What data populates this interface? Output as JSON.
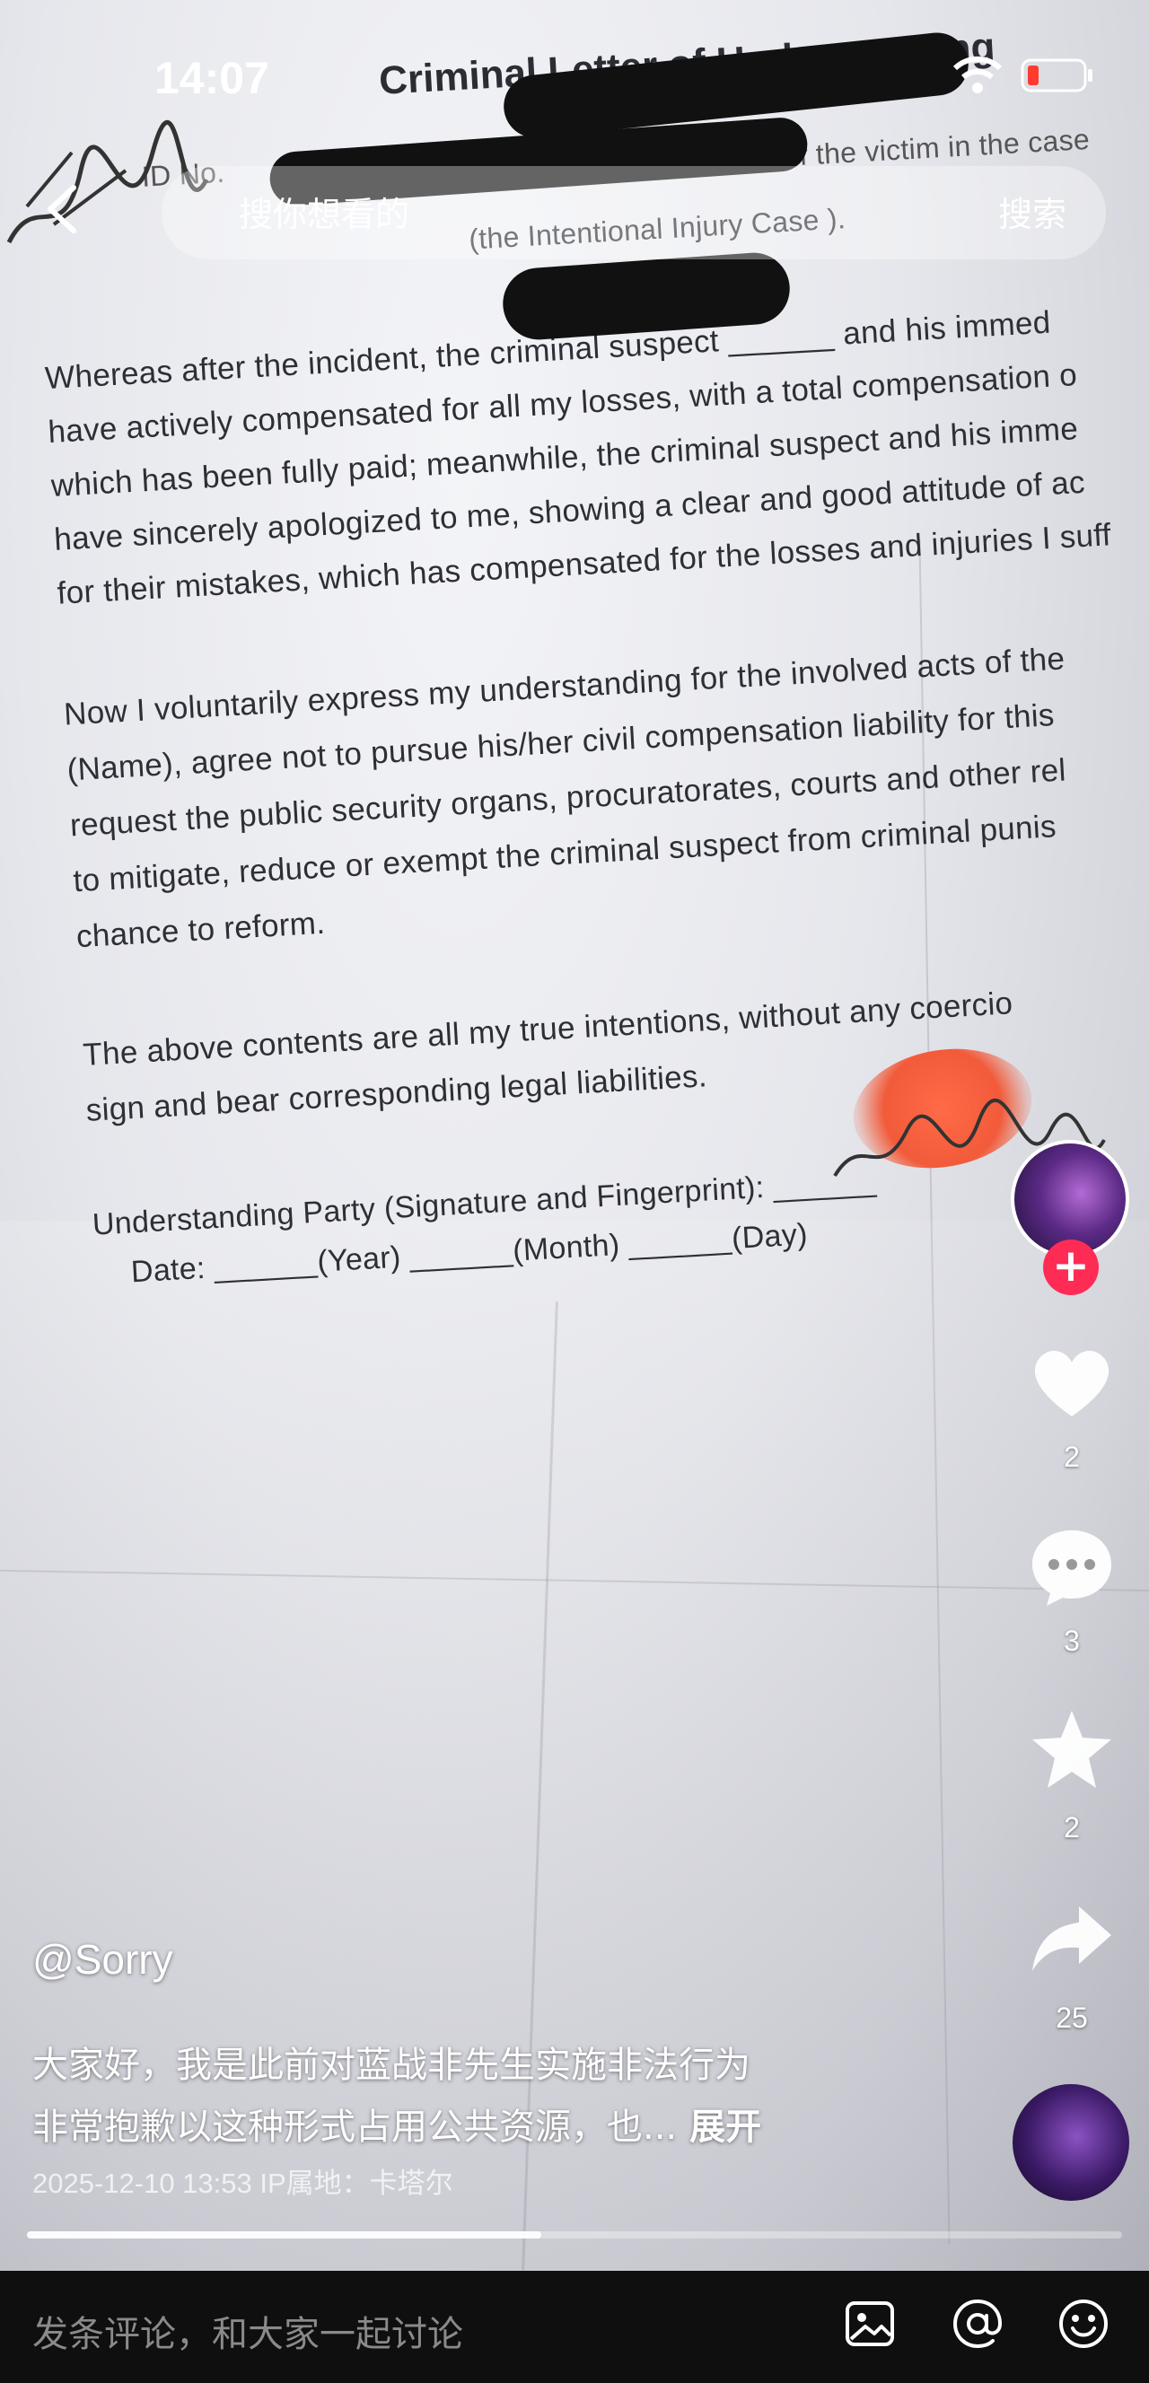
{
  "status_bar": {
    "time": "14:07"
  },
  "search": {
    "placeholder": "搜你想看的",
    "button": "搜索"
  },
  "document": {
    "title": "Criminal Letter of Understanding",
    "header_fragment_1": "ID No.",
    "header_fragment_2": "relative of the victim in the case",
    "case_line": "(the Intentional Injury Case ).",
    "paragraph_1": [
      "Whereas after the incident, the criminal suspect ______   and his immed",
      "have actively compensated for all my losses, with a total compensation o",
      "which has been fully paid; meanwhile, the criminal suspect and his imme",
      "have sincerely apologized to me, showing a clear and good attitude of ac",
      "for their mistakes, which has compensated for the losses and injuries I suff"
    ],
    "paragraph_2": [
      "Now I voluntarily express my understanding for the involved acts of the",
      "(Name), agree not to pursue his/her civil compensation liability for this",
      "request the public security organs, procuratorates, courts and other rel",
      "to mitigate, reduce or exempt the criminal suspect from criminal punis",
      "chance to reform."
    ],
    "paragraph_3": [
      "The above contents are all my true intentions, without any coercio",
      "sign and bear corresponding legal liabilities."
    ],
    "signature_line": "Understanding Party (Signature and Fingerprint): ______",
    "date_line": "Date: ______(Year) ______(Month) ______(Day)"
  },
  "rail": {
    "like_count": "2",
    "comment_count": "3",
    "favorite_count": "2",
    "share_count": "25"
  },
  "post": {
    "author": "@Sorry",
    "caption_line_1": "大家好，我是此前对蓝战非先生实施非法行为",
    "caption_line_2": "非常抱歉以这种形式占用公共资源，也...",
    "expand_label": "展开",
    "meta": "2025-12-10 13:53  IP属地：卡塔尔"
  },
  "progress": {
    "fraction": 0.47
  },
  "bottom_bar": {
    "comment_placeholder": "发条评论，和大家一起讨论"
  },
  "icons": [
    "back-icon",
    "wifi-icon",
    "battery-icon",
    "heart-icon",
    "comment-icon",
    "star-icon",
    "share-icon",
    "image-icon",
    "at-icon",
    "emoji-icon"
  ],
  "colors": {
    "follow_accent": "#fe2c55",
    "bottom_bar": "#0f0f0f"
  }
}
